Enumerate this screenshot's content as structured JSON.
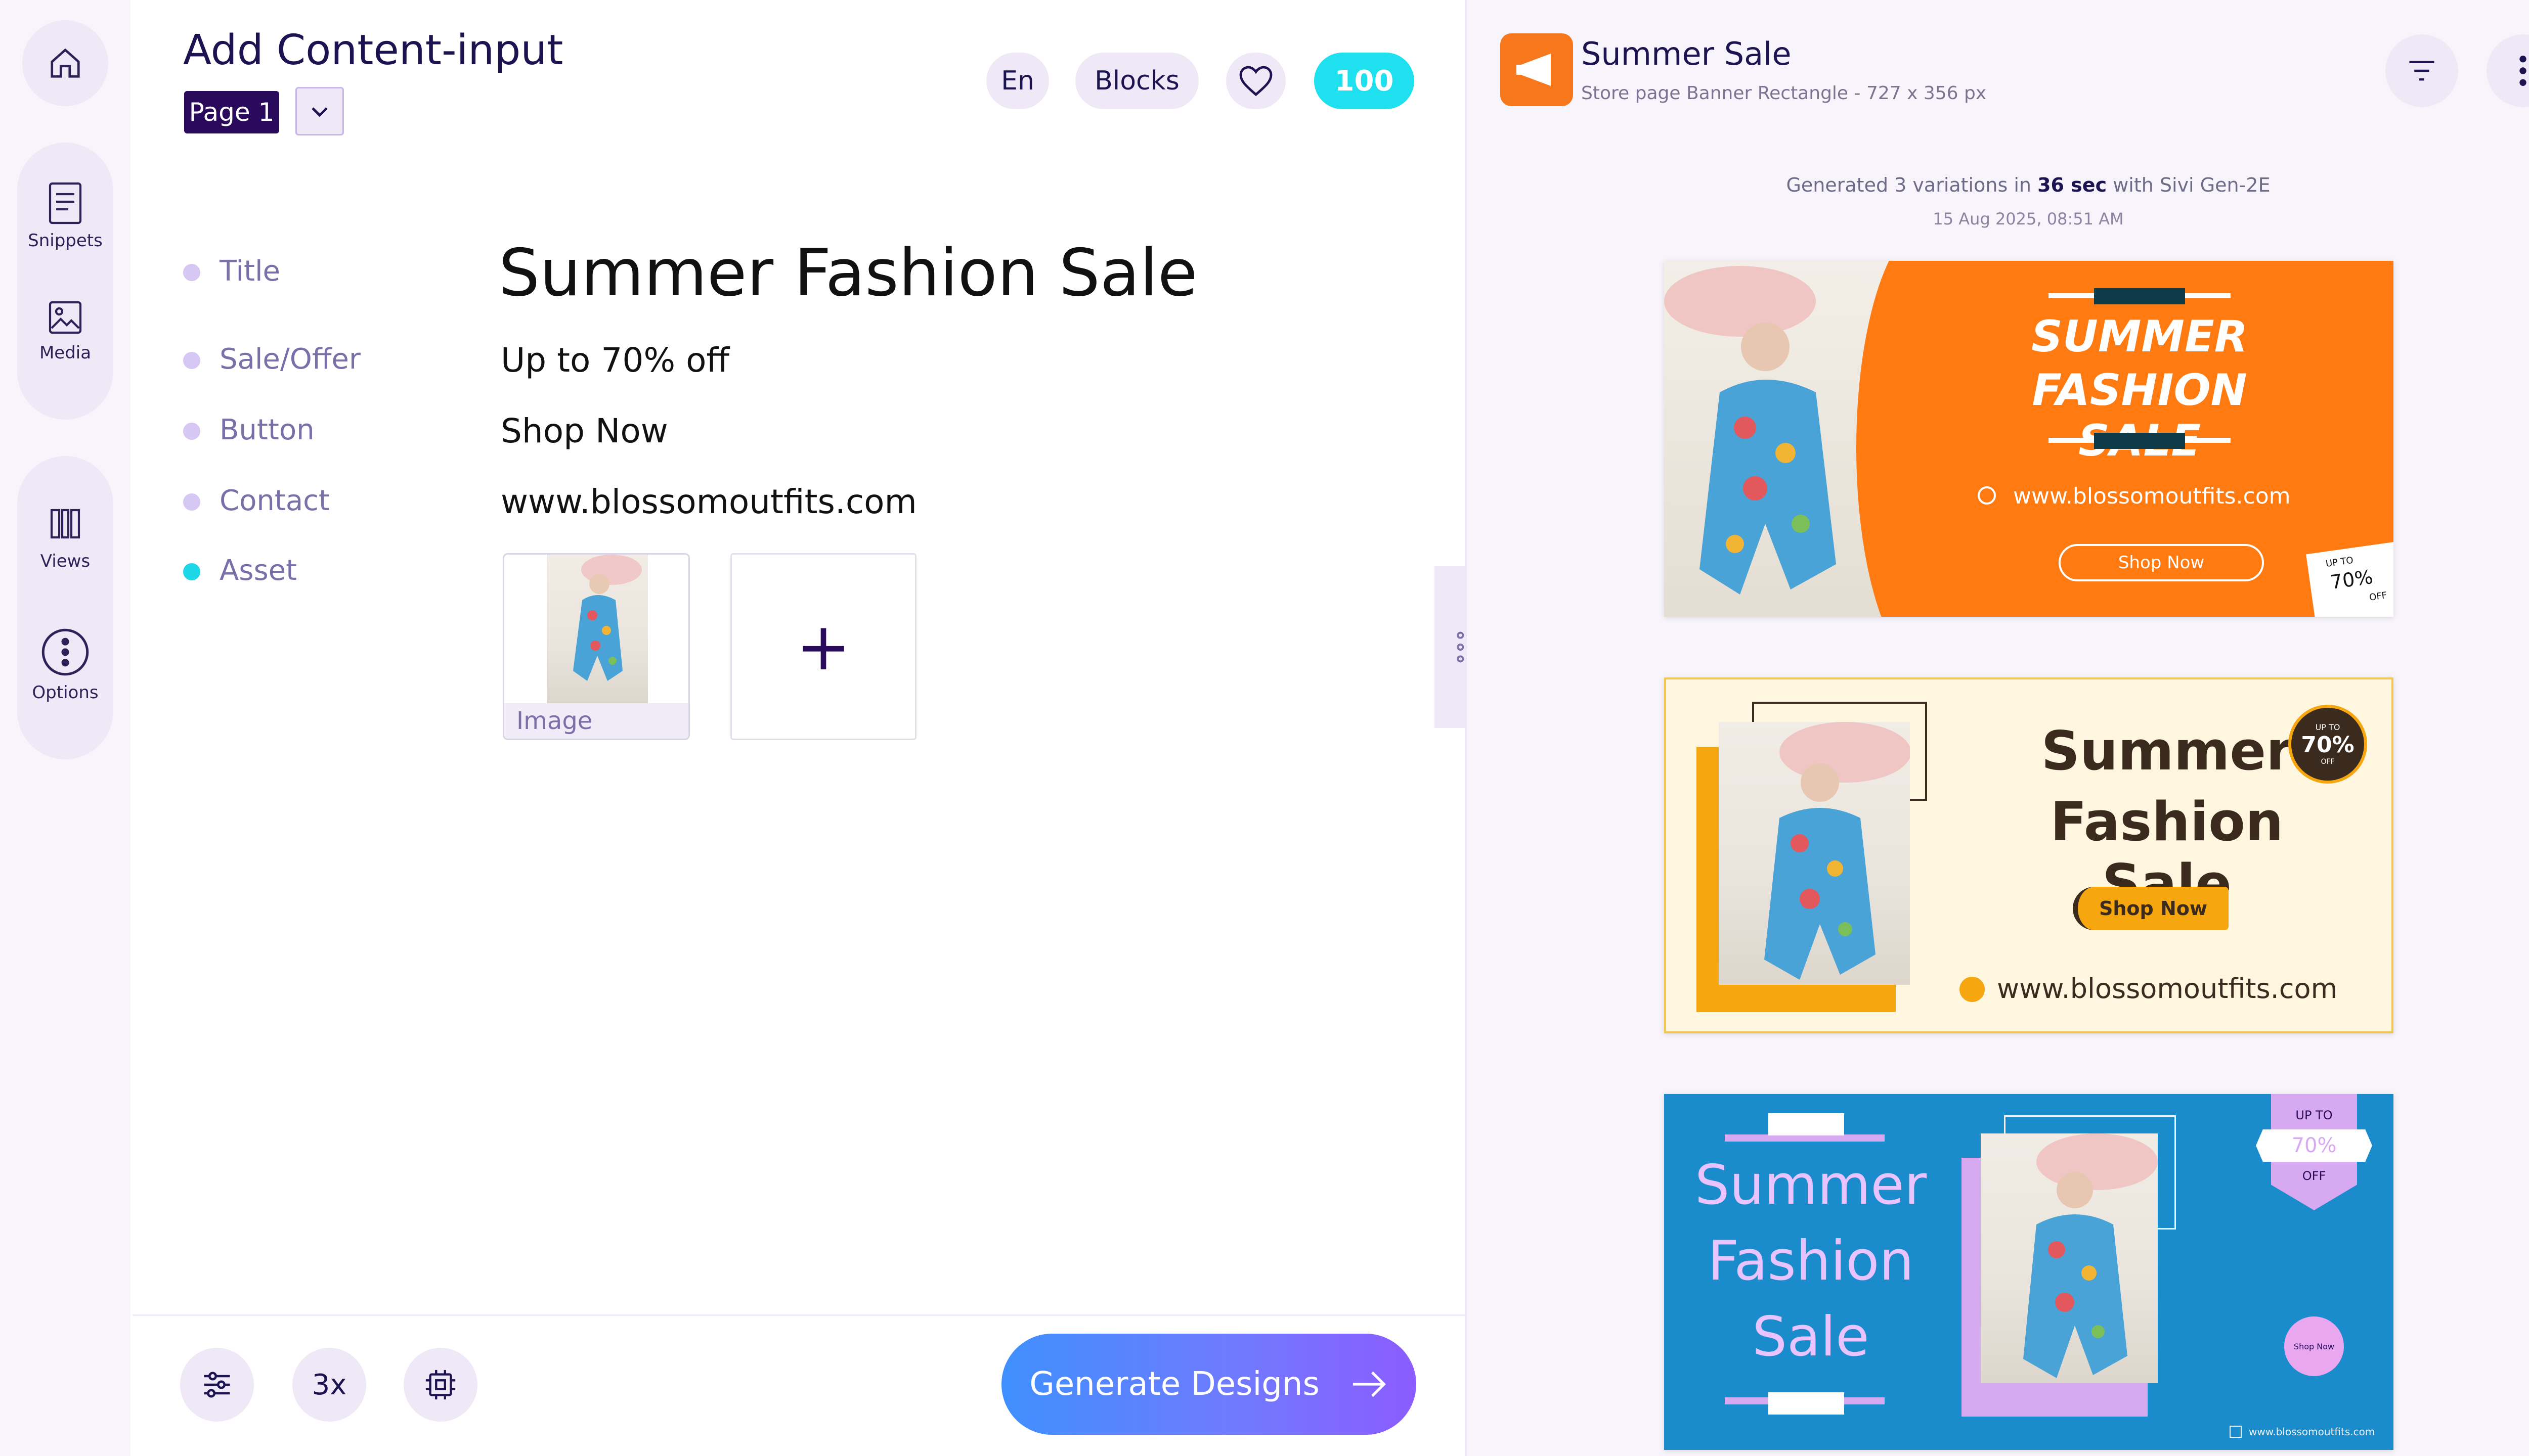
{
  "sidebar": {
    "items": [
      {
        "label": "Snippets",
        "icon": "document-icon"
      },
      {
        "label": "Media",
        "icon": "image-icon"
      },
      {
        "label": "Views",
        "icon": "columns-icon"
      },
      {
        "label": "Options",
        "icon": "more-vertical-icon"
      }
    ]
  },
  "editor": {
    "title": "Add Content-input",
    "page_label": "Page 1",
    "lang": "En",
    "blocks": "Blocks",
    "credits": "100",
    "fields": [
      {
        "label": "Title",
        "value": "Summer Fashion Sale"
      },
      {
        "label": "Sale/Offer",
        "value": "Up to 70% off"
      },
      {
        "label": "Button",
        "value": "Shop Now"
      },
      {
        "label": "Contact",
        "value": "www.blossomoutfits.com"
      },
      {
        "label": "Asset",
        "value": ""
      }
    ],
    "asset_caption": "Image",
    "add_symbol": "+",
    "multiplier": "3x",
    "generate_label": "Generate Designs"
  },
  "preview": {
    "title": "Summer Sale",
    "subtitle": "Store page Banner Rectangle - 727 x 356 px",
    "gen_prefix": "Generated 3 variations in",
    "gen_time": "36 sec",
    "gen_suffix": "with Sivi Gen-2E",
    "gen_date": "15 Aug 2025, 08:51 AM"
  },
  "banners": {
    "b1": {
      "line1": "SUMMER",
      "line2": "FASHION SALE",
      "url": "www.blossomoutfits.com",
      "cta": "Shop Now",
      "upto": "UP TO",
      "pct": "70%",
      "off": "OFF"
    },
    "b2": {
      "line1": "Summer",
      "line2": "Fashion Sale",
      "cta": "Shop Now",
      "url": "www.blossomoutfits.com",
      "upto": "UP TO",
      "pct": "70%",
      "off": "OFF"
    },
    "b3": {
      "line1": "Summer",
      "line2": "Fashion",
      "line3": "Sale",
      "upto": "UP TO",
      "pct": "70%",
      "off": "OFF",
      "cta": "Shop Now",
      "url": "www.blossomoutfits.com"
    }
  },
  "colors": {
    "accent": "#2a0a5b",
    "cyan": "#1ee0ee",
    "orange": "#ff7a11",
    "blue": "#1a8ccb",
    "lavender": "#efe9f7"
  }
}
